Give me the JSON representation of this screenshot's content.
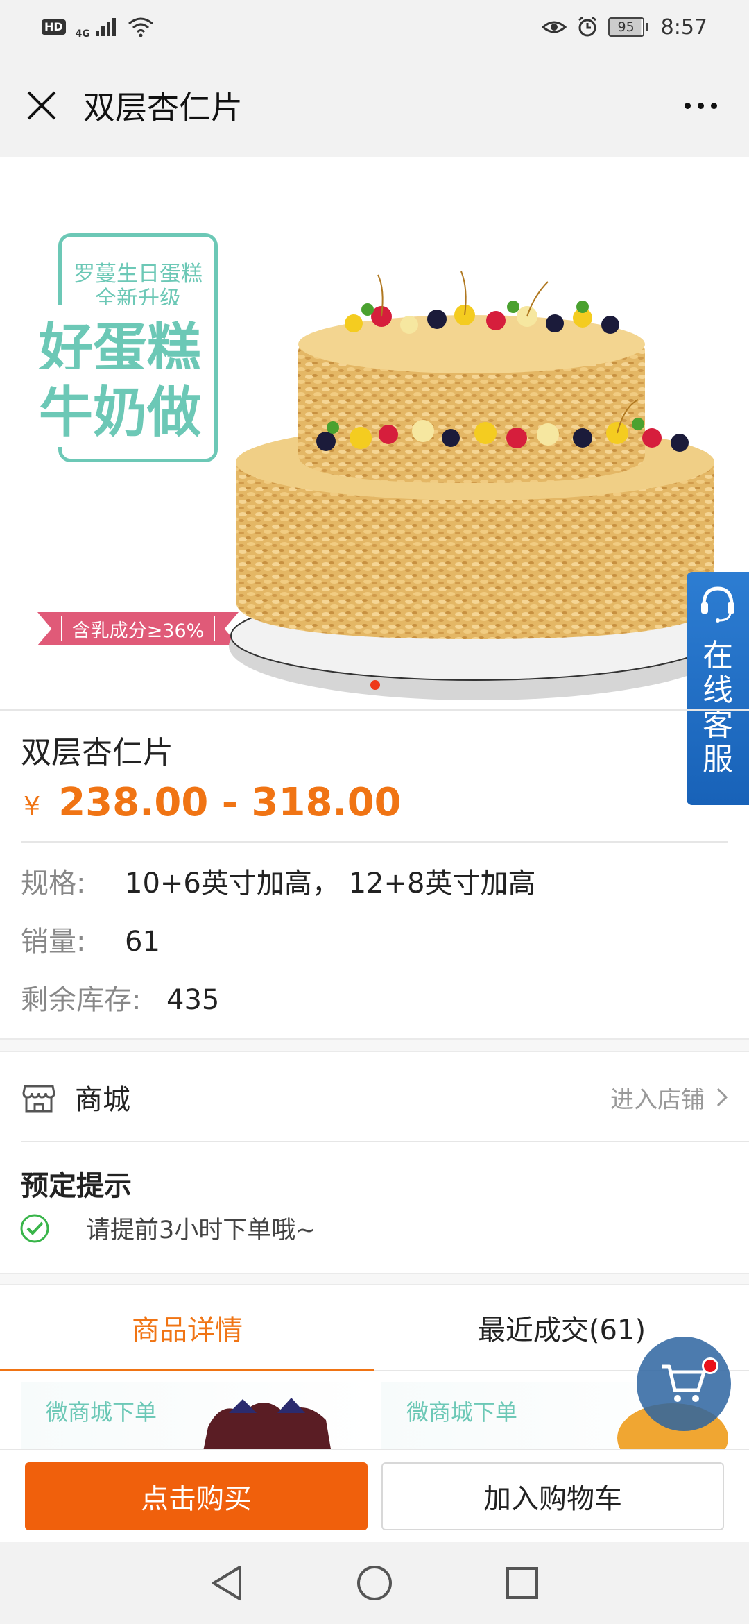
{
  "status_bar": {
    "hd": "HD",
    "network": "4G",
    "battery": "95",
    "time": "8:57"
  },
  "header": {
    "title": "双层杏仁片"
  },
  "hero": {
    "promo_line1": "罗蔓生日蛋糕",
    "promo_line2": "全新升级",
    "promo_big1": "好蛋糕",
    "promo_big2": "牛奶做",
    "ribbon": "含乳成分≥36%",
    "carousel_index": 1,
    "carousel_count": 1
  },
  "service": {
    "label": "在线客服"
  },
  "product": {
    "name": "双层杏仁片",
    "currency": "¥",
    "price": "238.00 - 318.00",
    "spec_label": "规格:",
    "spec_value": "10+6英寸加高， 12+8英寸加高",
    "sales_label": "销量:",
    "sales_value": "61",
    "stock_label": "剩余库存:",
    "stock_value": "435"
  },
  "store": {
    "label": "商城",
    "enter": "进入店铺"
  },
  "notice": {
    "title": "预定提示",
    "text": "请提前3小时下单哦~"
  },
  "tabs": [
    {
      "label": "商品详情",
      "active": true
    },
    {
      "label": "最近成交(61)",
      "active": false
    }
  ],
  "detail": {
    "card1": "微商城下单",
    "card2": "微商城下单"
  },
  "actions": {
    "buy": "点击购买",
    "add_cart": "加入购物车"
  },
  "colors": {
    "accent": "#f07414",
    "buy_button": "#f0600c",
    "promo_green": "#6cc8b6",
    "service_blue": "#1862b8"
  }
}
